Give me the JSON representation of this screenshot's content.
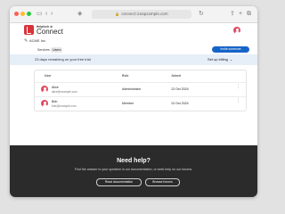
{
  "browser": {
    "url": "connect.iceapsample.com"
  },
  "header": {
    "brand_small": "Helptech ⚙",
    "brand_big": "Connect"
  },
  "org": {
    "name": "ACME Inc"
  },
  "tabs": [
    {
      "label": "Services"
    },
    {
      "label": "Users"
    }
  ],
  "invite_label": "Invite someone",
  "trial": {
    "message": "23 days remaining on your free trial",
    "billing_label": "Set up billing"
  },
  "table": {
    "columns": [
      "User",
      "Role",
      "Joined"
    ],
    "rows": [
      {
        "name": "Alice",
        "email": "alice@example.com",
        "role": "Administrator",
        "joined": "13 Oct 2024"
      },
      {
        "name": "Bob",
        "email": "bob@example.com",
        "role": "Member",
        "joined": "13 Oct 2024"
      }
    ]
  },
  "help": {
    "title": "Need help?",
    "text": "Find the answer to your question in our documentation, or seek help on our forums.",
    "docs_button": "Read documentation",
    "forums_button": "Browse forums"
  },
  "colors": {
    "brand_red": "#d6353b",
    "primary_blue": "#1764c8",
    "trial_bg": "#e6eef8",
    "footer_bg": "#2b2b2b"
  }
}
